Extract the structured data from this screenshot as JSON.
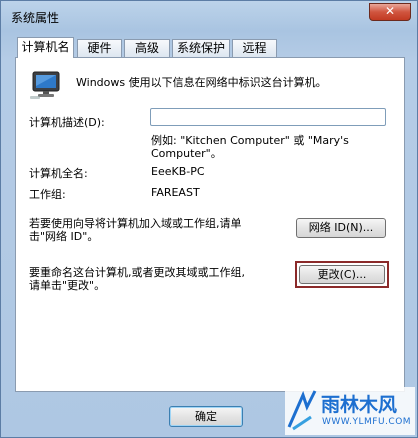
{
  "window": {
    "title": "系统属性",
    "close_glyph": "✕"
  },
  "tabs": [
    {
      "label": "计算机名"
    },
    {
      "label": "硬件"
    },
    {
      "label": "高级"
    },
    {
      "label": "系统保护"
    },
    {
      "label": "远程"
    }
  ],
  "info_text": "Windows 使用以下信息在网络中标识这台计算机。",
  "description": {
    "label": "计算机描述(D):",
    "value": "",
    "example_line1": "例如: \"Kitchen Computer\" 或 \"Mary's",
    "example_line2": "Computer\"。"
  },
  "full_name": {
    "label": "计算机全名:",
    "value": "EeeKB-PC"
  },
  "workgroup": {
    "label": "工作组:",
    "value": "FAREAST"
  },
  "network_id": {
    "text_line1": "若要使用向导将计算机加入域或工作组,请单",
    "text_line2": "击\"网络 ID\"。",
    "button_label": "网络 ID(N)..."
  },
  "rename": {
    "text_line1": "要重命名这台计算机,或者更改其域或工作组,",
    "text_line2": "请单击\"更改\"。",
    "button_label": "更改(C)..."
  },
  "footer": {
    "ok_label": "确定"
  },
  "watermark": {
    "brand": "雨林木风",
    "url": "WWW.YLMFU.COM"
  },
  "colors": {
    "focus_ring": "#8b2a2a",
    "close_button": "#c23a22",
    "brand_blue": "#1d6fd0"
  }
}
